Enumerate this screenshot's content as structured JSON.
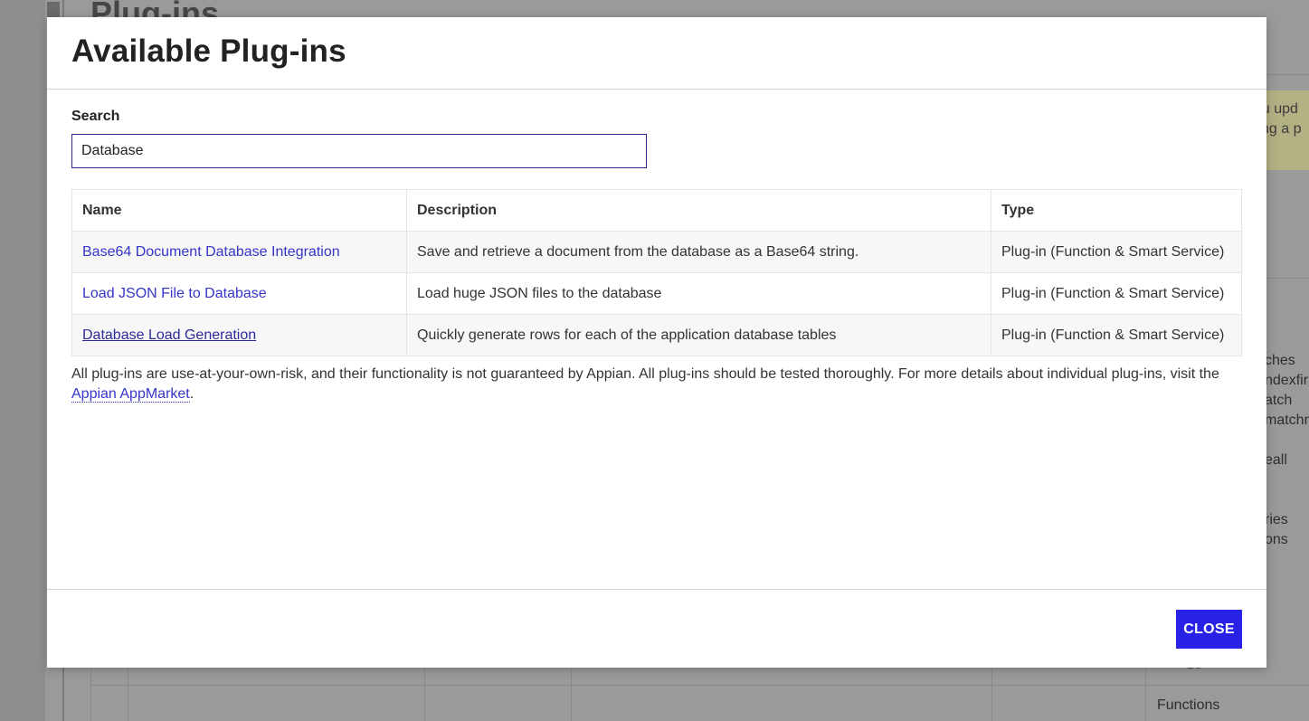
{
  "background": {
    "page_title": "Plug-ins",
    "notice_lines": [
      "ou upd",
      "ting a p"
    ],
    "list_items": [
      "ches",
      "ndexfir",
      "atch",
      "matchr",
      "",
      "eall",
      "",
      "",
      "ries",
      "ons"
    ],
    "serialize_text": "ze",
    "functions_label": "Functions"
  },
  "modal": {
    "title": "Available Plug-ins",
    "search": {
      "label": "Search",
      "value": "Database"
    },
    "table": {
      "headers": [
        "Name",
        "Description",
        "Type"
      ],
      "rows": [
        {
          "name": "Base64 Document Database Integration",
          "description": "Save and retrieve a document from the database as a Base64 string.",
          "type": "Plug-in (Function & Smart Service)"
        },
        {
          "name": "Load JSON File to Database",
          "description": "Load huge JSON files to the database",
          "type": "Plug-in (Function & Smart Service)"
        },
        {
          "name": "Database Load Generation",
          "description": "Quickly generate rows for each of the application database tables",
          "type": "Plug-in (Function & Smart Service)"
        }
      ]
    },
    "disclaimer": {
      "text": "All plug-ins are use-at-your-own-risk, and their functionality is not guaranteed by Appian. All plug-ins should be tested thoroughly. For more details about individual plug-ins, visit the",
      "link_text": "Appian AppMarket",
      "suffix": "."
    },
    "close_label": "CLOSE"
  },
  "colors": {
    "accent": "#2822e6",
    "link": "#3535c9",
    "overlay": "#9a9a9a"
  }
}
